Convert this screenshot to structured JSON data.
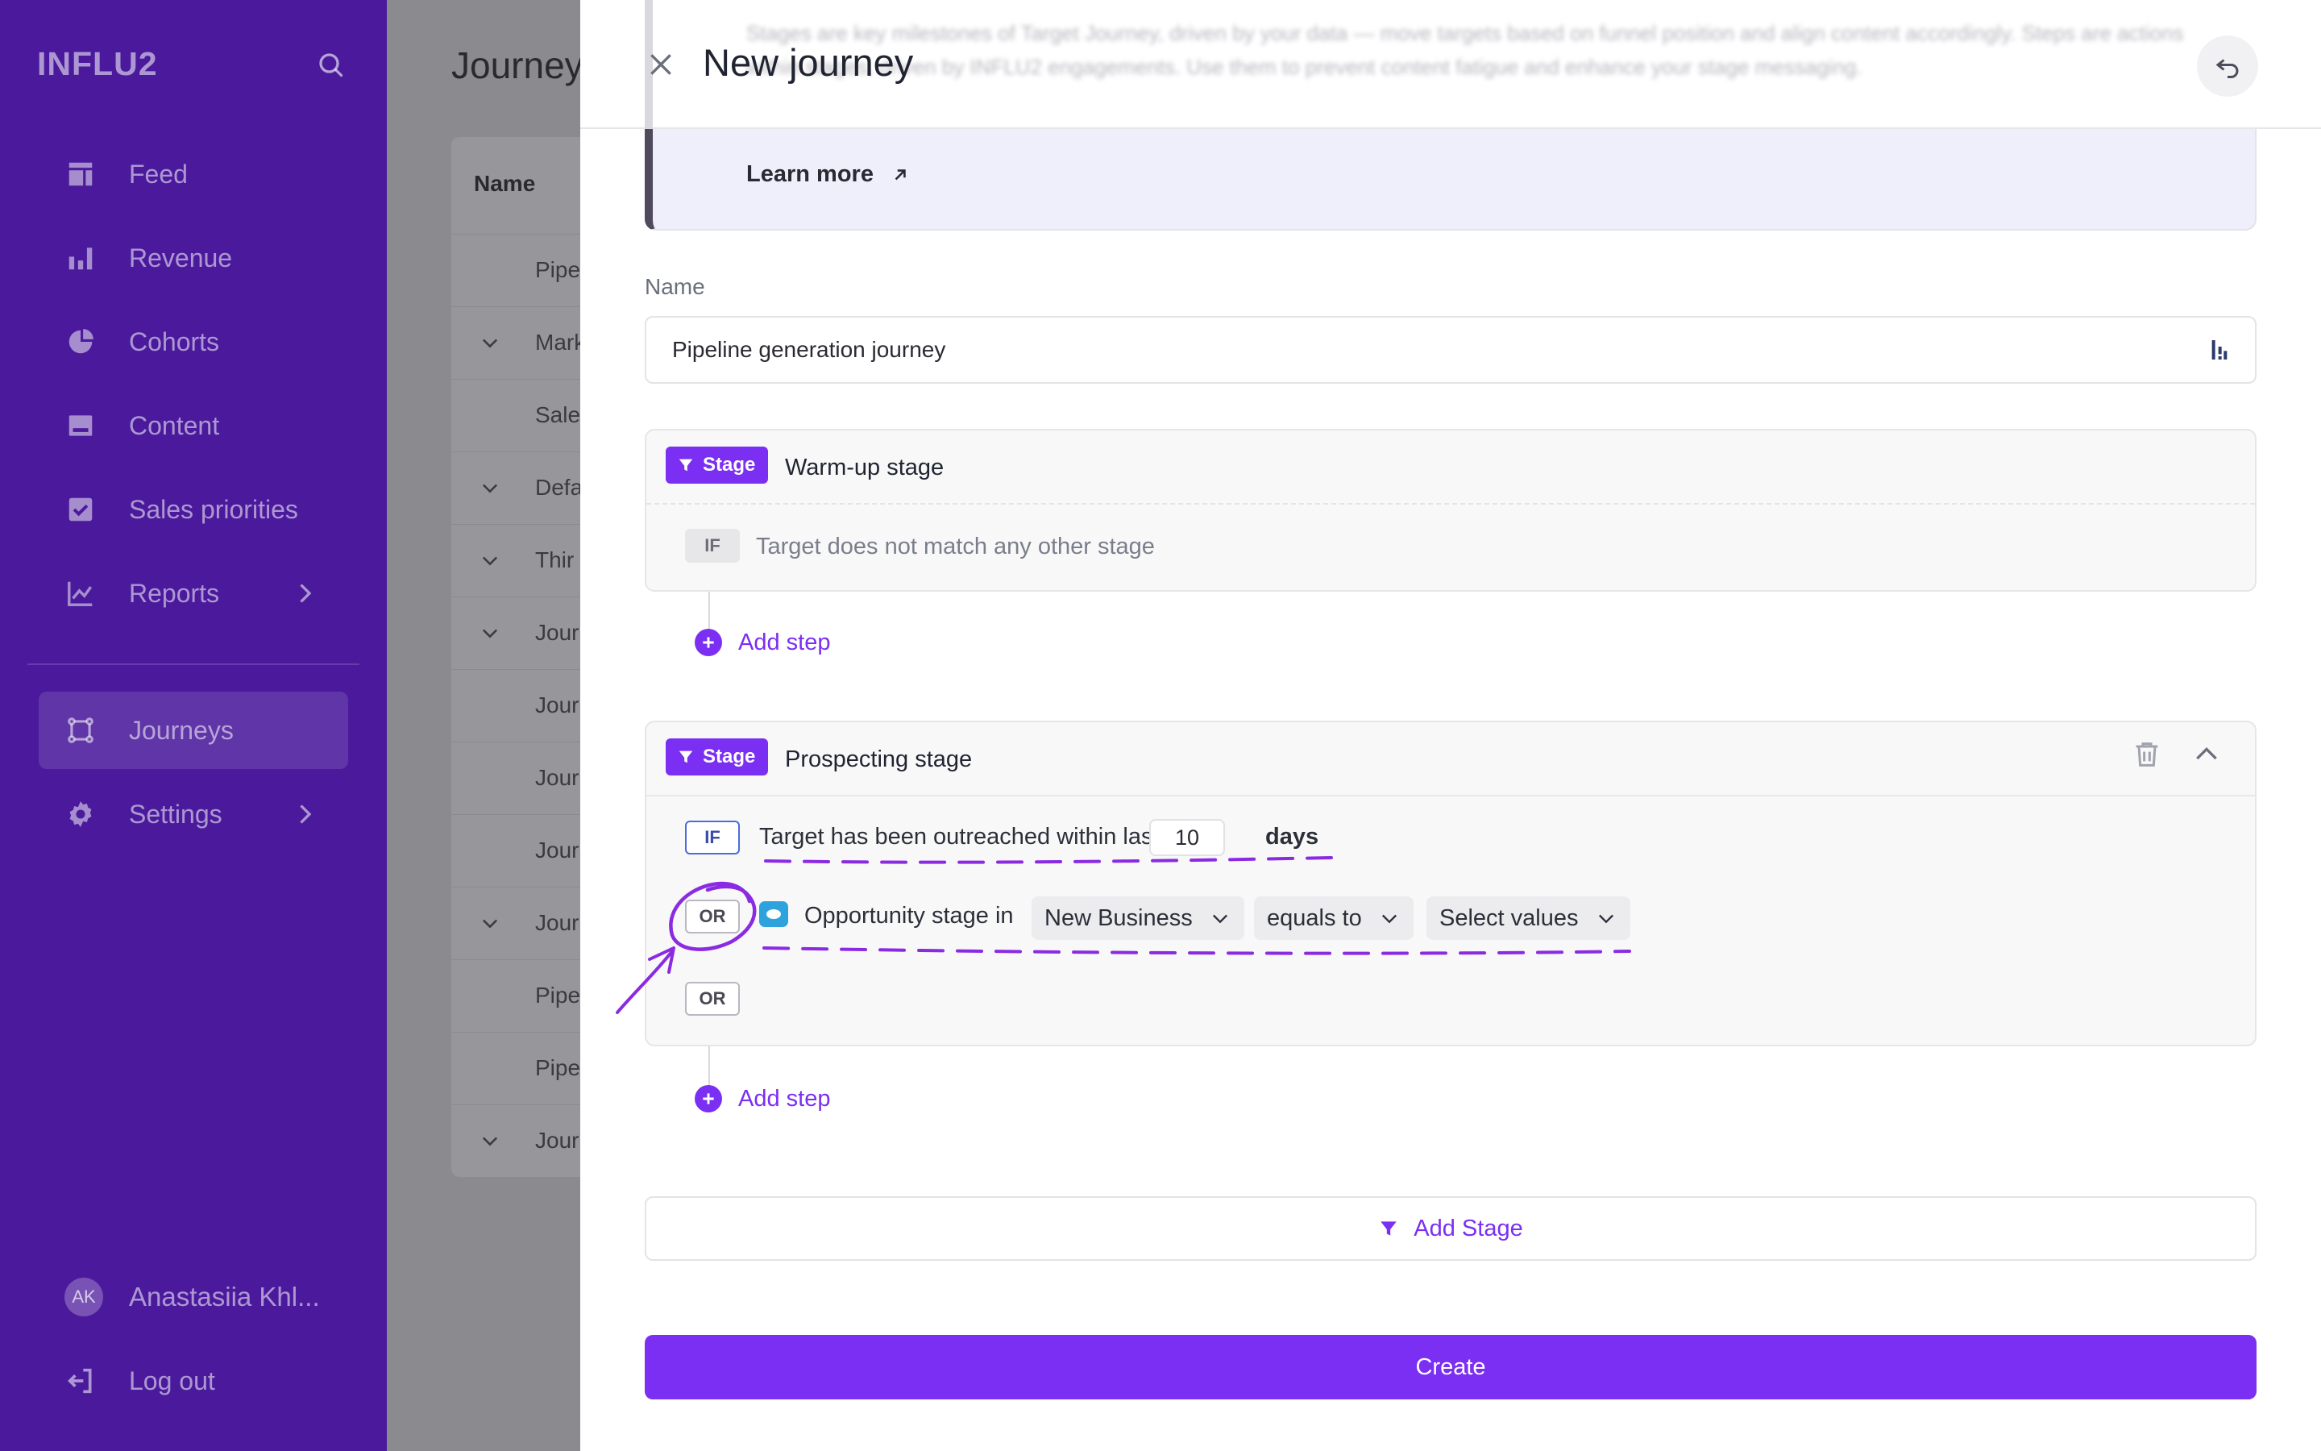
{
  "app": {
    "logo": "INFLU2"
  },
  "sidebar": {
    "items": [
      {
        "label": "Feed",
        "icon": "feed-icon"
      },
      {
        "label": "Revenue",
        "icon": "bar-chart-icon"
      },
      {
        "label": "Cohorts",
        "icon": "pie-chart-icon"
      },
      {
        "label": "Content",
        "icon": "content-icon"
      },
      {
        "label": "Sales priorities",
        "icon": "checkbox-icon"
      },
      {
        "label": "Reports",
        "icon": "line-chart-icon",
        "has_submenu": true
      },
      {
        "label": "Journeys",
        "icon": "journeys-icon",
        "active": true
      },
      {
        "label": "Settings",
        "icon": "gear-icon",
        "has_submenu": true
      }
    ],
    "user": {
      "initials": "AK",
      "name": "Anastasiia Khl..."
    },
    "logout_label": "Log out"
  },
  "background_page": {
    "title": "Journeys",
    "column_header": "Name",
    "rows": [
      "Pipe",
      "Mark",
      "Sale",
      "Defa",
      "Thir",
      "Jour",
      "Jour",
      "Jour",
      "Jour",
      "Jour",
      "Pipe",
      "Pipe",
      "Jour"
    ]
  },
  "panel": {
    "title": "New journey",
    "header_blur_text": "Stages are key milestones of Target Journey, driven by your data — move targets based on funnel position and align content accordingly. Steps are actions within stages, driven by INFLU2 engagements. Use them to prevent content fatigue and enhance your stage messaging.",
    "learn_more": "Learn more",
    "name_label": "Name",
    "name_value": "Pipeline generation journey",
    "stages": [
      {
        "badge": "Stage",
        "name": "Warm-up stage",
        "conditions": [
          {
            "operator": "IF",
            "text": "Target does not match any other stage"
          }
        ],
        "add_step": "Add step"
      },
      {
        "badge": "Stage",
        "name": "Prospecting stage",
        "conditions": [
          {
            "operator": "IF",
            "text": "Target has been outreached within last",
            "days_value": "10",
            "days_label": "days"
          },
          {
            "operator": "OR",
            "text": "Opportunity stage in",
            "field_value": "New Business",
            "comparator": "equals to",
            "values_placeholder": "Select values"
          },
          {
            "operator": "OR"
          }
        ],
        "add_step": "Add step"
      }
    ],
    "add_stage": "Add Stage",
    "create": "Create"
  },
  "colors": {
    "sidebar_bg": "#4b1a9c",
    "accent": "#7b2ff2",
    "annotation": "#8a2be2"
  }
}
